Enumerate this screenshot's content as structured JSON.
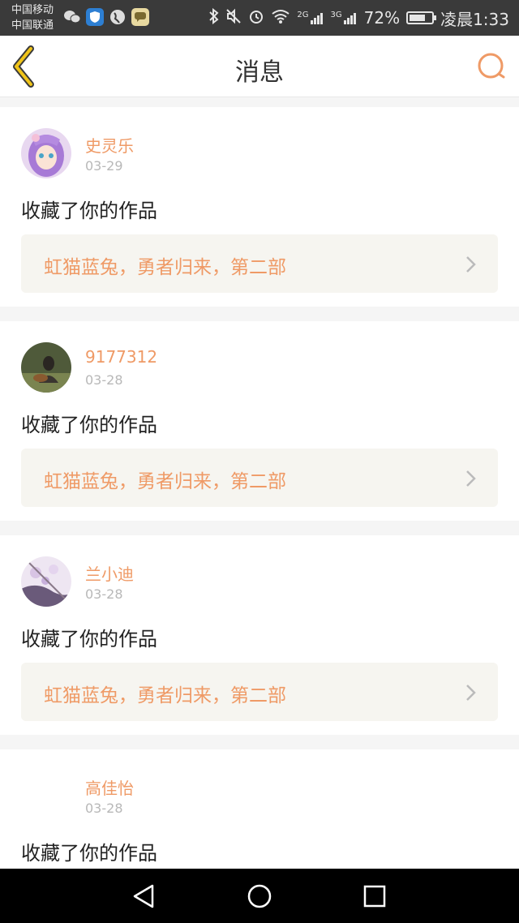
{
  "status_bar": {
    "carrier_1": "中国移动",
    "carrier_2": "中国联通",
    "net_2g": "2G",
    "net_3g": "3G",
    "battery_text": "72%",
    "battery_level": 0.72,
    "time": "凌晨1:33",
    "icons": [
      "wechat-icon",
      "shield-icon",
      "globe-icon",
      "chat-bubble-icon",
      "bluetooth-icon",
      "mute-icon",
      "alarm-icon",
      "wifi-icon",
      "signal-icon",
      "battery-icon"
    ]
  },
  "header": {
    "title": "消息",
    "back_icon": "chevron-left-icon",
    "search_icon": "search-icon"
  },
  "colors": {
    "accent": "#ef9a66",
    "back_icon": "#f0c419",
    "page_bg": "#f5f5f5"
  },
  "messages": [
    {
      "username": "史灵乐",
      "date": "03-29",
      "action": "收藏了你的作品",
      "work_title": "虹猫蓝兔，勇者归来，第二部"
    },
    {
      "username": "9177312",
      "date": "03-28",
      "action": "收藏了你的作品",
      "work_title": "虹猫蓝兔，勇者归来，第二部"
    },
    {
      "username": "兰小迪",
      "date": "03-28",
      "action": "收藏了你的作品",
      "work_title": "虹猫蓝兔，勇者归来，第二部"
    },
    {
      "username": "高佳怡",
      "date": "03-28",
      "action": "收藏了你的作品",
      "work_title": ""
    }
  ],
  "nav": {
    "back": "triangle-back-icon",
    "home": "circle-home-icon",
    "recent": "square-recent-icon"
  }
}
